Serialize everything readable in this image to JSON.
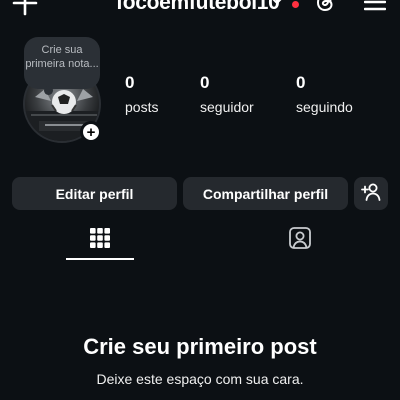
{
  "header": {
    "username": "focoemfutebol10"
  },
  "note": {
    "prompt": "Crie sua primeira nota..."
  },
  "stats": [
    {
      "value": "0",
      "label": "posts"
    },
    {
      "value": "0",
      "label": "seguidor"
    },
    {
      "value": "0",
      "label": "seguindo"
    }
  ],
  "actions": {
    "edit_label": "Editar perfil",
    "share_label": "Compartilhar perfil"
  },
  "empty_state": {
    "title": "Crie seu primeiro post",
    "subtitle": "Deixe este espaço com sua cara."
  },
  "icons": {
    "create": "plus-icon",
    "switch_account": "chevron-down-icon",
    "threads": "threads-icon",
    "menu": "hamburger-menu-icon",
    "add_story": "plus-icon",
    "suggest_people": "add-person-icon",
    "grid_tab": "grid-icon",
    "tagged_tab": "tagged-person-icon"
  },
  "colors": {
    "background": "#0c1014",
    "button": "#25292e",
    "notification_dot": "#ff3040",
    "text": "#ffffff"
  }
}
